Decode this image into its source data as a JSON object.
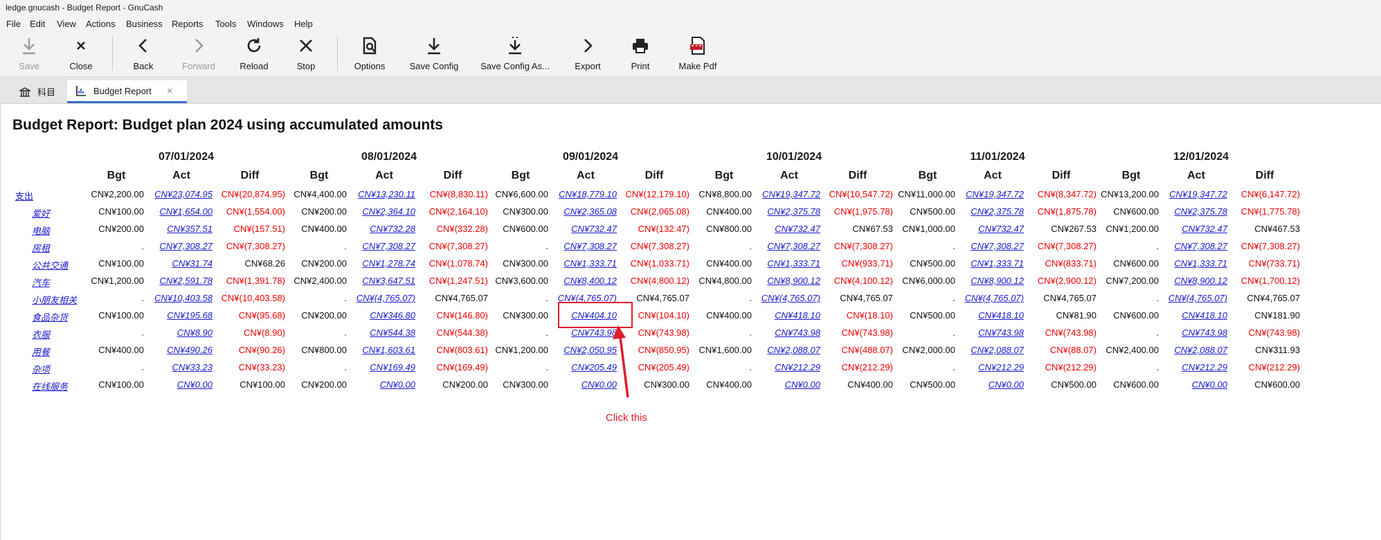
{
  "window": {
    "title": "ledge.gnucash - Budget Report - GnuCash"
  },
  "menu": [
    "File",
    "Edit",
    "View",
    "Actions",
    "Business",
    "Reports",
    "Tools",
    "Windows",
    "Help"
  ],
  "toolbar": {
    "save": "Save",
    "close": "Close",
    "back": "Back",
    "forward": "Forward",
    "reload": "Reload",
    "stop": "Stop",
    "options": "Options",
    "save_config": "Save Config",
    "save_config_as": "Save Config As...",
    "export": "Export",
    "print": "Print",
    "make_pdf": "Make Pdf"
  },
  "tabs": {
    "accounts": "科目",
    "report": "Budget Report",
    "close_glyph": "×"
  },
  "report": {
    "title": "Budget Report: Budget plan 2024 using accumulated amounts",
    "periods": [
      "07/01/2024",
      "08/01/2024",
      "09/01/2024",
      "10/01/2024",
      "11/01/2024",
      "12/01/2024"
    ],
    "col_labels": {
      "bgt": "Bgt",
      "act": "Act",
      "diff": "Diff"
    },
    "rows": [
      {
        "account": "支出",
        "cells": [
          [
            "CN¥2,200.00",
            "CN¥23,074.95",
            "CN¥(20,874.95)"
          ],
          [
            "CN¥4,400.00",
            "CN¥13,230.11",
            "CN¥(8,830.11)"
          ],
          [
            "CN¥6,600.00",
            "CN¥18,779.10",
            "CN¥(12,179.10)"
          ],
          [
            "CN¥8,800.00",
            "CN¥19,347.72",
            "CN¥(10,547.72)"
          ],
          [
            "CN¥11,000.00",
            "CN¥19,347.72",
            "CN¥(8,347.72)"
          ],
          [
            "CN¥13,200.00",
            "CN¥19,347.72",
            "CN¥(6,147.72)"
          ]
        ]
      },
      {
        "account": "爱好",
        "cells": [
          [
            "CN¥100.00",
            "CN¥1,654.00",
            "CN¥(1,554.00)"
          ],
          [
            "CN¥200.00",
            "CN¥2,364.10",
            "CN¥(2,164.10)"
          ],
          [
            "CN¥300.00",
            "CN¥2,365.08",
            "CN¥(2,065.08)"
          ],
          [
            "CN¥400.00",
            "CN¥2,375.78",
            "CN¥(1,975.78)"
          ],
          [
            "CN¥500.00",
            "CN¥2,375.78",
            "CN¥(1,875.78)"
          ],
          [
            "CN¥600.00",
            "CN¥2,375.78",
            "CN¥(1,775.78)"
          ]
        ]
      },
      {
        "account": "电脑",
        "cells": [
          [
            "CN¥200.00",
            "CN¥357.51",
            "CN¥(157.51)"
          ],
          [
            "CN¥400.00",
            "CN¥732.28",
            "CN¥(332.28)"
          ],
          [
            "CN¥600.00",
            "CN¥732.47",
            "CN¥(132.47)"
          ],
          [
            "CN¥800.00",
            "CN¥732.47",
            "CN¥67.53"
          ],
          [
            "CN¥1,000.00",
            "CN¥732.47",
            "CN¥267.53"
          ],
          [
            "CN¥1,200.00",
            "CN¥732.47",
            "CN¥467.53"
          ]
        ]
      },
      {
        "account": "房租",
        "cells": [
          [
            ".",
            "CN¥7,308.27",
            "CN¥(7,308.27)"
          ],
          [
            ".",
            "CN¥7,308.27",
            "CN¥(7,308.27)"
          ],
          [
            ".",
            "CN¥7,308.27",
            "CN¥(7,308.27)"
          ],
          [
            ".",
            "CN¥7,308.27",
            "CN¥(7,308.27)"
          ],
          [
            ".",
            "CN¥7,308.27",
            "CN¥(7,308.27)"
          ],
          [
            ".",
            "CN¥7,308.27",
            "CN¥(7,308.27)"
          ]
        ]
      },
      {
        "account": "公共交通",
        "cells": [
          [
            "CN¥100.00",
            "CN¥31.74",
            "CN¥68.26"
          ],
          [
            "CN¥200.00",
            "CN¥1,278.74",
            "CN¥(1,078.74)"
          ],
          [
            "CN¥300.00",
            "CN¥1,333.71",
            "CN¥(1,033.71)"
          ],
          [
            "CN¥400.00",
            "CN¥1,333.71",
            "CN¥(933.71)"
          ],
          [
            "CN¥500.00",
            "CN¥1,333.71",
            "CN¥(833.71)"
          ],
          [
            "CN¥600.00",
            "CN¥1,333.71",
            "CN¥(733.71)"
          ]
        ]
      },
      {
        "account": "汽车",
        "cells": [
          [
            "CN¥1,200.00",
            "CN¥2,591.78",
            "CN¥(1,391.78)"
          ],
          [
            "CN¥2,400.00",
            "CN¥3,647.51",
            "CN¥(1,247.51)"
          ],
          [
            "CN¥3,600.00",
            "CN¥8,400.12",
            "CN¥(4,800.12)"
          ],
          [
            "CN¥4,800.00",
            "CN¥8,900.12",
            "CN¥(4,100.12)"
          ],
          [
            "CN¥6,000.00",
            "CN¥8,900.12",
            "CN¥(2,900.12)"
          ],
          [
            "CN¥7,200.00",
            "CN¥8,900.12",
            "CN¥(1,700.12)"
          ]
        ]
      },
      {
        "account": "小朋友相关",
        "cells": [
          [
            ".",
            "CN¥10,403.58",
            "CN¥(10,403.58)"
          ],
          [
            ".",
            "CN¥(4,765.07)",
            "CN¥4,765.07"
          ],
          [
            ".",
            "CN¥(4,765.07)",
            "CN¥4,765.07"
          ],
          [
            ".",
            "CN¥(4,765.07)",
            "CN¥4,765.07"
          ],
          [
            ".",
            "CN¥(4,765.07)",
            "CN¥4,765.07"
          ],
          [
            ".",
            "CN¥(4,765.07)",
            "CN¥4,765.07"
          ]
        ]
      },
      {
        "account": "食品杂货",
        "cells": [
          [
            "CN¥100.00",
            "CN¥195.68",
            "CN¥(95.68)"
          ],
          [
            "CN¥200.00",
            "CN¥346.80",
            "CN¥(146.80)"
          ],
          [
            "CN¥300.00",
            "CN¥404.10",
            "CN¥(104.10)"
          ],
          [
            "CN¥400.00",
            "CN¥418.10",
            "CN¥(18.10)"
          ],
          [
            "CN¥500.00",
            "CN¥418.10",
            "CN¥81.90"
          ],
          [
            "CN¥600.00",
            "CN¥418.10",
            "CN¥181.90"
          ]
        ]
      },
      {
        "account": "衣服",
        "cells": [
          [
            ".",
            "CN¥8.90",
            "CN¥(8.90)"
          ],
          [
            ".",
            "CN¥544.38",
            "CN¥(544.38)"
          ],
          [
            ".",
            "CN¥743.98",
            "CN¥(743.98)"
          ],
          [
            ".",
            "CN¥743.98",
            "CN¥(743.98)"
          ],
          [
            ".",
            "CN¥743.98",
            "CN¥(743.98)"
          ],
          [
            ".",
            "CN¥743.98",
            "CN¥(743.98)"
          ]
        ]
      },
      {
        "account": "用餐",
        "cells": [
          [
            "CN¥400.00",
            "CN¥490.26",
            "CN¥(90.26)"
          ],
          [
            "CN¥800.00",
            "CN¥1,603.61",
            "CN¥(803.61)"
          ],
          [
            "CN¥1,200.00",
            "CN¥2,050.95",
            "CN¥(850.95)"
          ],
          [
            "CN¥1,600.00",
            "CN¥2,088.07",
            "CN¥(488.07)"
          ],
          [
            "CN¥2,000.00",
            "CN¥2,088.07",
            "CN¥(88.07)"
          ],
          [
            "CN¥2,400.00",
            "CN¥2,088.07",
            "CN¥311.93"
          ]
        ]
      },
      {
        "account": "杂项",
        "cells": [
          [
            ".",
            "CN¥33.23",
            "CN¥(33.23)"
          ],
          [
            ".",
            "CN¥169.49",
            "CN¥(169.49)"
          ],
          [
            ".",
            "CN¥205.49",
            "CN¥(205.49)"
          ],
          [
            ".",
            "CN¥212.29",
            "CN¥(212.29)"
          ],
          [
            ".",
            "CN¥212.29",
            "CN¥(212.29)"
          ],
          [
            ".",
            "CN¥212.29",
            "CN¥(212.29)"
          ]
        ]
      },
      {
        "account": "在线服务",
        "cells": [
          [
            "CN¥100.00",
            "CN¥0.00",
            "CN¥100.00"
          ],
          [
            "CN¥200.00",
            "CN¥0.00",
            "CN¥200.00"
          ],
          [
            "CN¥300.00",
            "CN¥0.00",
            "CN¥300.00"
          ],
          [
            "CN¥400.00",
            "CN¥0.00",
            "CN¥400.00"
          ],
          [
            "CN¥500.00",
            "CN¥0.00",
            "CN¥500.00"
          ],
          [
            "CN¥600.00",
            "CN¥0.00",
            "CN¥600.00"
          ]
        ]
      }
    ]
  },
  "annotation": {
    "text": "Click this",
    "color": "#e21c2a"
  },
  "colors": {
    "negative": "#ee0000",
    "link": "#1a1ad0",
    "active_tab": "#3b6fc8"
  }
}
